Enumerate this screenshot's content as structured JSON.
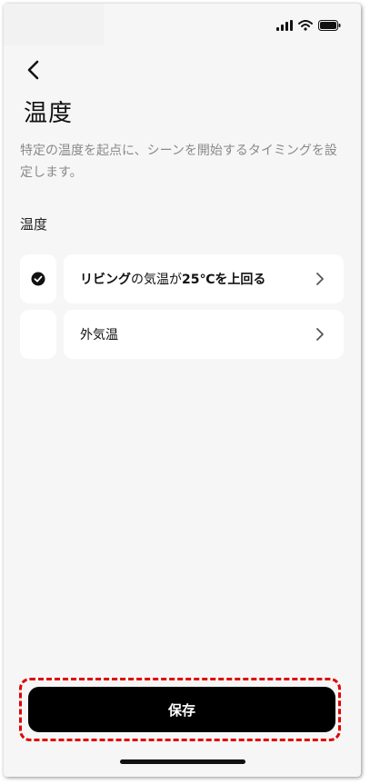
{
  "header": {
    "title": "温度",
    "description": "特定の温度を起点に、シーンを開始するタイミングを設定します。"
  },
  "section": {
    "label": "温度"
  },
  "options": [
    {
      "label_prefix": "リビング",
      "label_middle": "の気温が",
      "label_suffix": "25℃を上回る",
      "selected": true
    },
    {
      "label": "外気温",
      "selected": false
    }
  ],
  "footer": {
    "save_label": "保存"
  },
  "colors": {
    "background": "#f6f6f6",
    "card": "#ffffff",
    "primary_button": "#000000",
    "highlight": "#e00000",
    "description_text": "#8a8a8a"
  },
  "icons": {
    "back": "chevron-left-icon",
    "selected": "check-circle-icon",
    "row_arrow": "chevron-right-icon",
    "status": [
      "signal-icon",
      "wifi-icon",
      "battery-icon"
    ]
  }
}
